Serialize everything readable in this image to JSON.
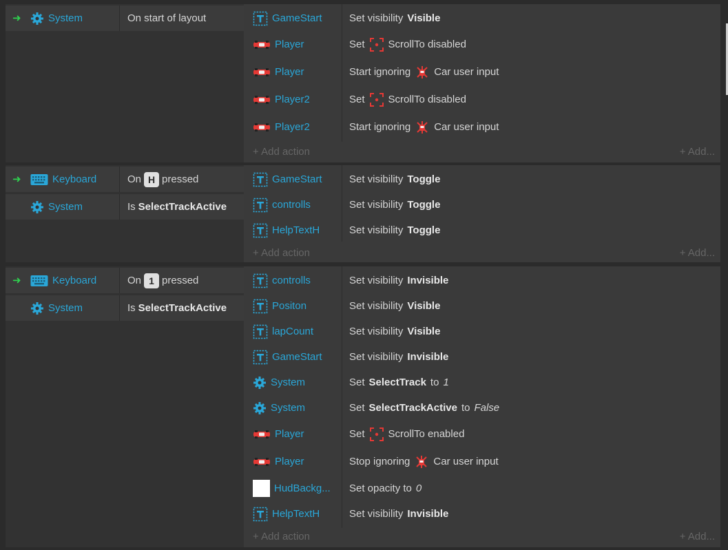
{
  "colors": {
    "background": "#2b2b2b",
    "block": "#3a3a3a",
    "object_name": "#2aa7d8",
    "arrow": "#2fd14f",
    "behavior_icon": "#e53935",
    "add_text": "#666666"
  },
  "ui": {
    "add_action": "Add action",
    "add_more": "Add..."
  },
  "events": [
    {
      "conditions": [
        {
          "object": "System",
          "icon": "gear-icon",
          "text": "On start of layout",
          "trigger": true
        }
      ],
      "actions": [
        {
          "object": "GameStart",
          "icon": "text-object-icon",
          "pre": "Set visibility",
          "bold": "Visible"
        },
        {
          "object": "Player",
          "icon": "car-sprite-icon",
          "pre": "Set",
          "behavior_icon": "scrollto-icon",
          "post": "ScrollTo disabled"
        },
        {
          "object": "Player",
          "icon": "car-sprite-icon",
          "pre": "Start ignoring",
          "behavior_icon": "car-behavior-icon",
          "post": "Car user input"
        },
        {
          "object": "Player2",
          "icon": "car-sprite-icon",
          "pre": "Set",
          "behavior_icon": "scrollto-icon",
          "post": "ScrollTo disabled"
        },
        {
          "object": "Player2",
          "icon": "car-sprite-icon",
          "pre": "Start ignoring",
          "behavior_icon": "car-behavior-icon",
          "post": "Car user input"
        }
      ]
    },
    {
      "conditions": [
        {
          "object": "Keyboard",
          "icon": "keyboard-icon",
          "pre": "On",
          "key": "H",
          "post": "pressed",
          "trigger": true
        },
        {
          "object": "System",
          "icon": "gear-icon",
          "pre": "Is",
          "bold": "SelectTrackActive"
        }
      ],
      "actions": [
        {
          "object": "GameStart",
          "icon": "text-object-icon",
          "pre": "Set visibility",
          "bold": "Toggle"
        },
        {
          "object": "controlls",
          "icon": "text-object-icon",
          "pre": "Set visibility",
          "bold": "Toggle"
        },
        {
          "object": "HelpTextH",
          "icon": "text-object-icon",
          "pre": "Set visibility",
          "bold": "Toggle"
        }
      ]
    },
    {
      "conditions": [
        {
          "object": "Keyboard",
          "icon": "keyboard-icon",
          "pre": "On",
          "key": "1",
          "post": "pressed",
          "trigger": true
        },
        {
          "object": "System",
          "icon": "gear-icon",
          "pre": "Is",
          "bold": "SelectTrackActive"
        }
      ],
      "actions": [
        {
          "object": "controlls",
          "icon": "text-object-icon",
          "pre": "Set visibility",
          "bold": "Invisible"
        },
        {
          "object": "Positon",
          "icon": "text-object-icon",
          "pre": "Set visibility",
          "bold": "Visible"
        },
        {
          "object": "lapCount",
          "icon": "text-object-icon",
          "pre": "Set visibility",
          "bold": "Visible"
        },
        {
          "object": "GameStart",
          "icon": "text-object-icon",
          "pre": "Set visibility",
          "bold": "Invisible"
        },
        {
          "object": "System",
          "icon": "gear-icon",
          "pre": "Set",
          "bold": "SelectTrack",
          "mid": "to",
          "italic": "1"
        },
        {
          "object": "System",
          "icon": "gear-icon",
          "pre": "Set",
          "bold": "SelectTrackActive",
          "mid": "to",
          "italic": "False"
        },
        {
          "object": "Player",
          "icon": "car-sprite-icon",
          "pre": "Set",
          "behavior_icon": "scrollto-icon",
          "post": "ScrollTo enabled"
        },
        {
          "object": "Player",
          "icon": "car-sprite-icon",
          "pre": "Stop ignoring",
          "behavior_icon": "car-behavior-icon",
          "post": "Car user input"
        },
        {
          "object": "HudBackg...",
          "icon": "white-square-icon",
          "pre": "Set opacity to",
          "italic": "0"
        },
        {
          "object": "HelpTextH",
          "icon": "text-object-icon",
          "pre": "Set visibility",
          "bold": "Invisible"
        }
      ]
    }
  ]
}
